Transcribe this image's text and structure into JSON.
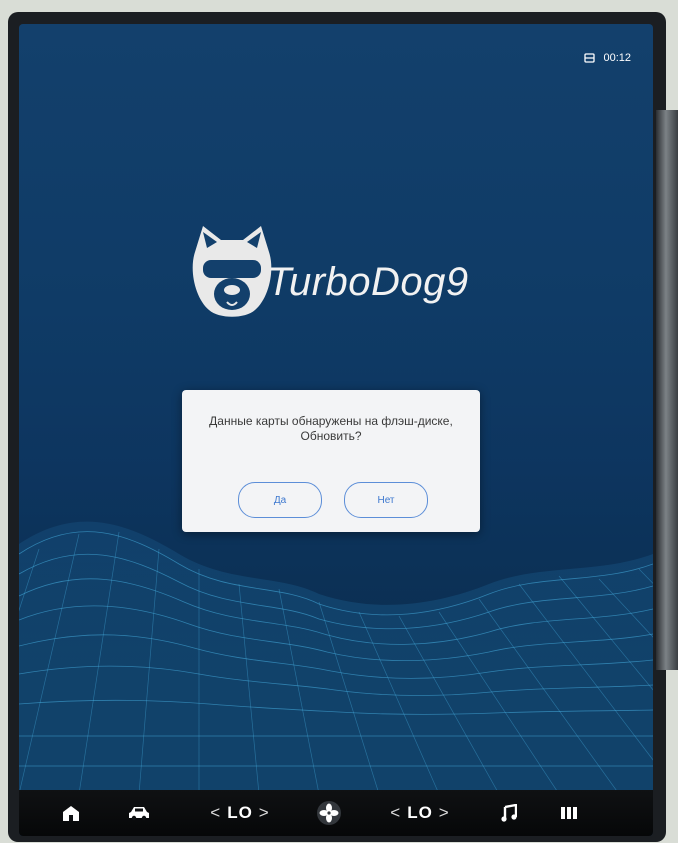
{
  "status_bar": {
    "time": "00:12",
    "icon": "usb-drive-icon"
  },
  "logo": {
    "brand_text": "TurboDog9",
    "icon": "dog-mascot-icon"
  },
  "dialog": {
    "message_line1": "Данные карты обнаружены на флэш-диске,",
    "message_line2": "Обновить?",
    "yes_label": "Да",
    "no_label": "Нет",
    "accent_color": "#3d78cf"
  },
  "dock": {
    "left_temp": {
      "prev": "<",
      "value": "LO",
      "next": ">"
    },
    "right_temp": {
      "prev": "<",
      "value": "LO",
      "next": ">"
    },
    "icons": [
      "home-icon",
      "car-icon",
      "fan-icon",
      "music-icon",
      "apps-icon"
    ]
  }
}
